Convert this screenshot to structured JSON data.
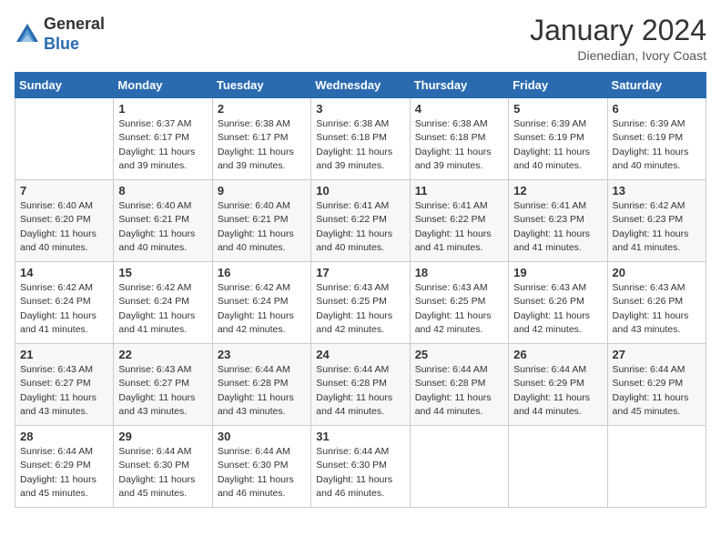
{
  "header": {
    "logo_line1": "General",
    "logo_line2": "Blue",
    "month": "January 2024",
    "location": "Dienedian, Ivory Coast"
  },
  "days_of_week": [
    "Sunday",
    "Monday",
    "Tuesday",
    "Wednesday",
    "Thursday",
    "Friday",
    "Saturday"
  ],
  "weeks": [
    [
      {
        "day": "",
        "sunrise": "",
        "sunset": "",
        "daylight": ""
      },
      {
        "day": "1",
        "sunrise": "Sunrise: 6:37 AM",
        "sunset": "Sunset: 6:17 PM",
        "daylight": "Daylight: 11 hours and 39 minutes."
      },
      {
        "day": "2",
        "sunrise": "Sunrise: 6:38 AM",
        "sunset": "Sunset: 6:17 PM",
        "daylight": "Daylight: 11 hours and 39 minutes."
      },
      {
        "day": "3",
        "sunrise": "Sunrise: 6:38 AM",
        "sunset": "Sunset: 6:18 PM",
        "daylight": "Daylight: 11 hours and 39 minutes."
      },
      {
        "day": "4",
        "sunrise": "Sunrise: 6:38 AM",
        "sunset": "Sunset: 6:18 PM",
        "daylight": "Daylight: 11 hours and 39 minutes."
      },
      {
        "day": "5",
        "sunrise": "Sunrise: 6:39 AM",
        "sunset": "Sunset: 6:19 PM",
        "daylight": "Daylight: 11 hours and 40 minutes."
      },
      {
        "day": "6",
        "sunrise": "Sunrise: 6:39 AM",
        "sunset": "Sunset: 6:19 PM",
        "daylight": "Daylight: 11 hours and 40 minutes."
      }
    ],
    [
      {
        "day": "7",
        "sunrise": "Sunrise: 6:40 AM",
        "sunset": "Sunset: 6:20 PM",
        "daylight": "Daylight: 11 hours and 40 minutes."
      },
      {
        "day": "8",
        "sunrise": "Sunrise: 6:40 AM",
        "sunset": "Sunset: 6:21 PM",
        "daylight": "Daylight: 11 hours and 40 minutes."
      },
      {
        "day": "9",
        "sunrise": "Sunrise: 6:40 AM",
        "sunset": "Sunset: 6:21 PM",
        "daylight": "Daylight: 11 hours and 40 minutes."
      },
      {
        "day": "10",
        "sunrise": "Sunrise: 6:41 AM",
        "sunset": "Sunset: 6:22 PM",
        "daylight": "Daylight: 11 hours and 40 minutes."
      },
      {
        "day": "11",
        "sunrise": "Sunrise: 6:41 AM",
        "sunset": "Sunset: 6:22 PM",
        "daylight": "Daylight: 11 hours and 41 minutes."
      },
      {
        "day": "12",
        "sunrise": "Sunrise: 6:41 AM",
        "sunset": "Sunset: 6:23 PM",
        "daylight": "Daylight: 11 hours and 41 minutes."
      },
      {
        "day": "13",
        "sunrise": "Sunrise: 6:42 AM",
        "sunset": "Sunset: 6:23 PM",
        "daylight": "Daylight: 11 hours and 41 minutes."
      }
    ],
    [
      {
        "day": "14",
        "sunrise": "Sunrise: 6:42 AM",
        "sunset": "Sunset: 6:24 PM",
        "daylight": "Daylight: 11 hours and 41 minutes."
      },
      {
        "day": "15",
        "sunrise": "Sunrise: 6:42 AM",
        "sunset": "Sunset: 6:24 PM",
        "daylight": "Daylight: 11 hours and 41 minutes."
      },
      {
        "day": "16",
        "sunrise": "Sunrise: 6:42 AM",
        "sunset": "Sunset: 6:24 PM",
        "daylight": "Daylight: 11 hours and 42 minutes."
      },
      {
        "day": "17",
        "sunrise": "Sunrise: 6:43 AM",
        "sunset": "Sunset: 6:25 PM",
        "daylight": "Daylight: 11 hours and 42 minutes."
      },
      {
        "day": "18",
        "sunrise": "Sunrise: 6:43 AM",
        "sunset": "Sunset: 6:25 PM",
        "daylight": "Daylight: 11 hours and 42 minutes."
      },
      {
        "day": "19",
        "sunrise": "Sunrise: 6:43 AM",
        "sunset": "Sunset: 6:26 PM",
        "daylight": "Daylight: 11 hours and 42 minutes."
      },
      {
        "day": "20",
        "sunrise": "Sunrise: 6:43 AM",
        "sunset": "Sunset: 6:26 PM",
        "daylight": "Daylight: 11 hours and 43 minutes."
      }
    ],
    [
      {
        "day": "21",
        "sunrise": "Sunrise: 6:43 AM",
        "sunset": "Sunset: 6:27 PM",
        "daylight": "Daylight: 11 hours and 43 minutes."
      },
      {
        "day": "22",
        "sunrise": "Sunrise: 6:43 AM",
        "sunset": "Sunset: 6:27 PM",
        "daylight": "Daylight: 11 hours and 43 minutes."
      },
      {
        "day": "23",
        "sunrise": "Sunrise: 6:44 AM",
        "sunset": "Sunset: 6:28 PM",
        "daylight": "Daylight: 11 hours and 43 minutes."
      },
      {
        "day": "24",
        "sunrise": "Sunrise: 6:44 AM",
        "sunset": "Sunset: 6:28 PM",
        "daylight": "Daylight: 11 hours and 44 minutes."
      },
      {
        "day": "25",
        "sunrise": "Sunrise: 6:44 AM",
        "sunset": "Sunset: 6:28 PM",
        "daylight": "Daylight: 11 hours and 44 minutes."
      },
      {
        "day": "26",
        "sunrise": "Sunrise: 6:44 AM",
        "sunset": "Sunset: 6:29 PM",
        "daylight": "Daylight: 11 hours and 44 minutes."
      },
      {
        "day": "27",
        "sunrise": "Sunrise: 6:44 AM",
        "sunset": "Sunset: 6:29 PM",
        "daylight": "Daylight: 11 hours and 45 minutes."
      }
    ],
    [
      {
        "day": "28",
        "sunrise": "Sunrise: 6:44 AM",
        "sunset": "Sunset: 6:29 PM",
        "daylight": "Daylight: 11 hours and 45 minutes."
      },
      {
        "day": "29",
        "sunrise": "Sunrise: 6:44 AM",
        "sunset": "Sunset: 6:30 PM",
        "daylight": "Daylight: 11 hours and 45 minutes."
      },
      {
        "day": "30",
        "sunrise": "Sunrise: 6:44 AM",
        "sunset": "Sunset: 6:30 PM",
        "daylight": "Daylight: 11 hours and 46 minutes."
      },
      {
        "day": "31",
        "sunrise": "Sunrise: 6:44 AM",
        "sunset": "Sunset: 6:30 PM",
        "daylight": "Daylight: 11 hours and 46 minutes."
      },
      {
        "day": "",
        "sunrise": "",
        "sunset": "",
        "daylight": ""
      },
      {
        "day": "",
        "sunrise": "",
        "sunset": "",
        "daylight": ""
      },
      {
        "day": "",
        "sunrise": "",
        "sunset": "",
        "daylight": ""
      }
    ]
  ]
}
